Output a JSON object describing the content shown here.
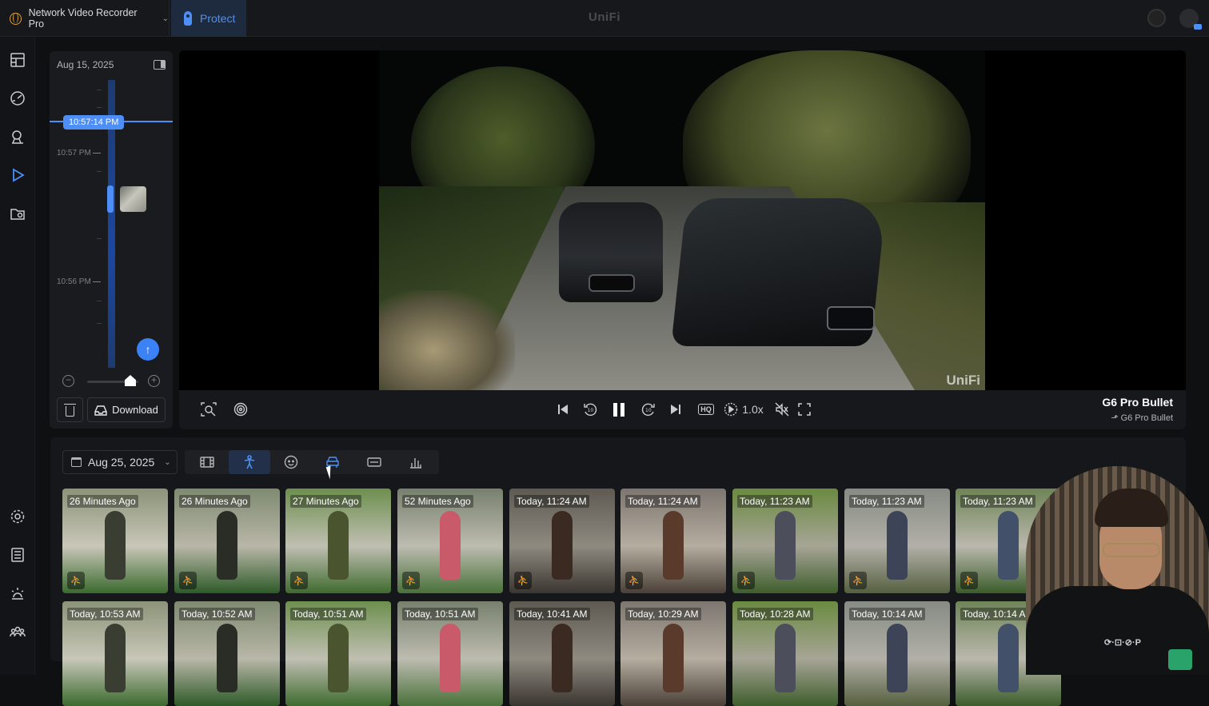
{
  "topbar": {
    "app_name": "Network Video Recorder Pro",
    "active_tab": "Protect",
    "brand": "UniFi"
  },
  "timeline": {
    "date": "Aug 15, 2025",
    "current_time": "10:57:14 PM",
    "ticks": [
      "10:57 PM",
      "10:56 PM"
    ],
    "download_label": "Download",
    "zoom_level": 0.85
  },
  "player": {
    "watermark": "UniFi",
    "speed": "1.0x",
    "hq_label": "HQ",
    "camera_name": "G6 Pro Bullet",
    "camera_sub": "G6 Pro Bullet"
  },
  "events": {
    "date": "Aug 25, 2025",
    "filters": [
      "all-events",
      "person",
      "face",
      "vehicle",
      "license-plate",
      "stats"
    ],
    "active_filter": "person",
    "row1": [
      "26 Minutes Ago",
      "26 Minutes Ago",
      "27 Minutes Ago",
      "52 Minutes Ago",
      "Today, 11:24 AM",
      "Today, 11:24 AM",
      "Today, 11:23 AM",
      "Today, 11:23 AM",
      "Today, 11:23 AM"
    ],
    "row2": [
      "Today, 10:53 AM",
      "Today, 10:52 AM",
      "Today, 10:51 AM",
      "Today, 10:51 AM",
      "Today, 10:41 AM",
      "Today, 10:29 AM",
      "Today, 10:28 AM",
      "Today, 10:14 AM",
      "Today, 10:14 AM"
    ]
  },
  "overlay": {
    "hoodie_text": "⟳·⊡·⊘·P"
  }
}
